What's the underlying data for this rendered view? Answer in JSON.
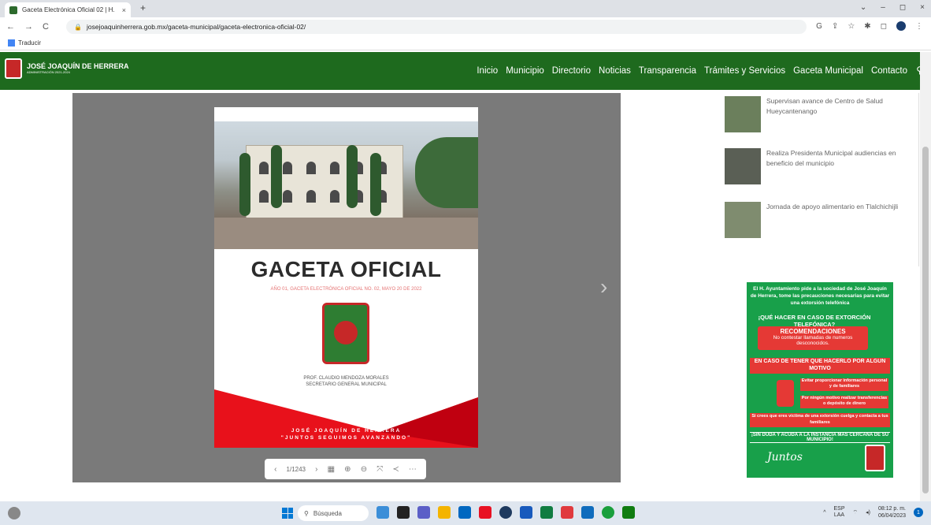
{
  "browser": {
    "tab_title": "Gaceta Electrónica Oficial 02 | H.",
    "tab_close": "×",
    "new_tab": "+",
    "window_controls": [
      "⌄",
      "–",
      "◻",
      "×"
    ],
    "url": "josejoaquinherrera.gob.mx/gaceta-municipal/gaceta-electronica-oficial-02/",
    "bookmark": "Traducir"
  },
  "site": {
    "logo_name": "JOSÉ JOAQUÍN DE HERRERA",
    "logo_sub": "ADMINISTRACIÓN 2021-2024",
    "menu": [
      "Inicio",
      "Municipio",
      "Directorio",
      "Noticias",
      "Transparencia",
      "Trámites y Servicios",
      "Gaceta Municipal",
      "Contacto"
    ]
  },
  "gaceta": {
    "title": "GACETA OFICIAL",
    "subtitle": "AÑO 01, GACETA ELECTRÓNICA OFICIAL NO. 02, MAYO 20 DE 2022",
    "signer_name": "PROF. CLAUDIO MENDOZA MORALES",
    "signer_role": "SECRETARIO GENERAL MUNICIPAL",
    "footer_line1": "JOSÉ JOAQUÍN DE HERRERA",
    "footer_line2": "\"JUNTOS SEGUIMOS AVANZANDO\""
  },
  "viewer_toolbar": {
    "page_indicator": "1/1243"
  },
  "news": [
    {
      "title": "Supervisan avance de Centro de Salud Hueycantenango"
    },
    {
      "title": "Realiza Presidenta Municipal audiencias en beneficio del municipio"
    },
    {
      "title": "Jornada de apoyo alimentario en Tlalchichijli"
    }
  ],
  "banner": {
    "intro": "El H. Ayuntamiento pide a la sociedad de José Joaquín de Herrera, tome las precauciones necesarias para evitar una extorsión telefónica",
    "heading": "¡QUÉ HACER EN CASO DE EXTORCIÓN TELEFÓNICA?",
    "reco_title": "RECOMENDACIONES",
    "reco_text": "No contestar llamadas de numeros desconocidos.",
    "case_title": "EN CASO DE TENER QUE HACERLO POR ALGUN MOTIVO",
    "tip1": "Evitar proporcionar información personal y de familiares",
    "tip2": "Por ningún motivo realizar transferencias o depósito de dinero",
    "tip3": "Si crees que eres víctima de una extorsión cuelga y contacta a tus familiares",
    "final": "¡SIN DUDA Y ACUDA A LA INSTANCIA MAS CERCANA DE SU MUNICIPIO!",
    "juntos": "Juntos"
  },
  "taskbar": {
    "search_label": "Búsqueda",
    "lang": "ESP",
    "lang_sub": "LAA",
    "time": "08:12 p. m.",
    "date": "06/04/2023",
    "notif_count": "1"
  }
}
